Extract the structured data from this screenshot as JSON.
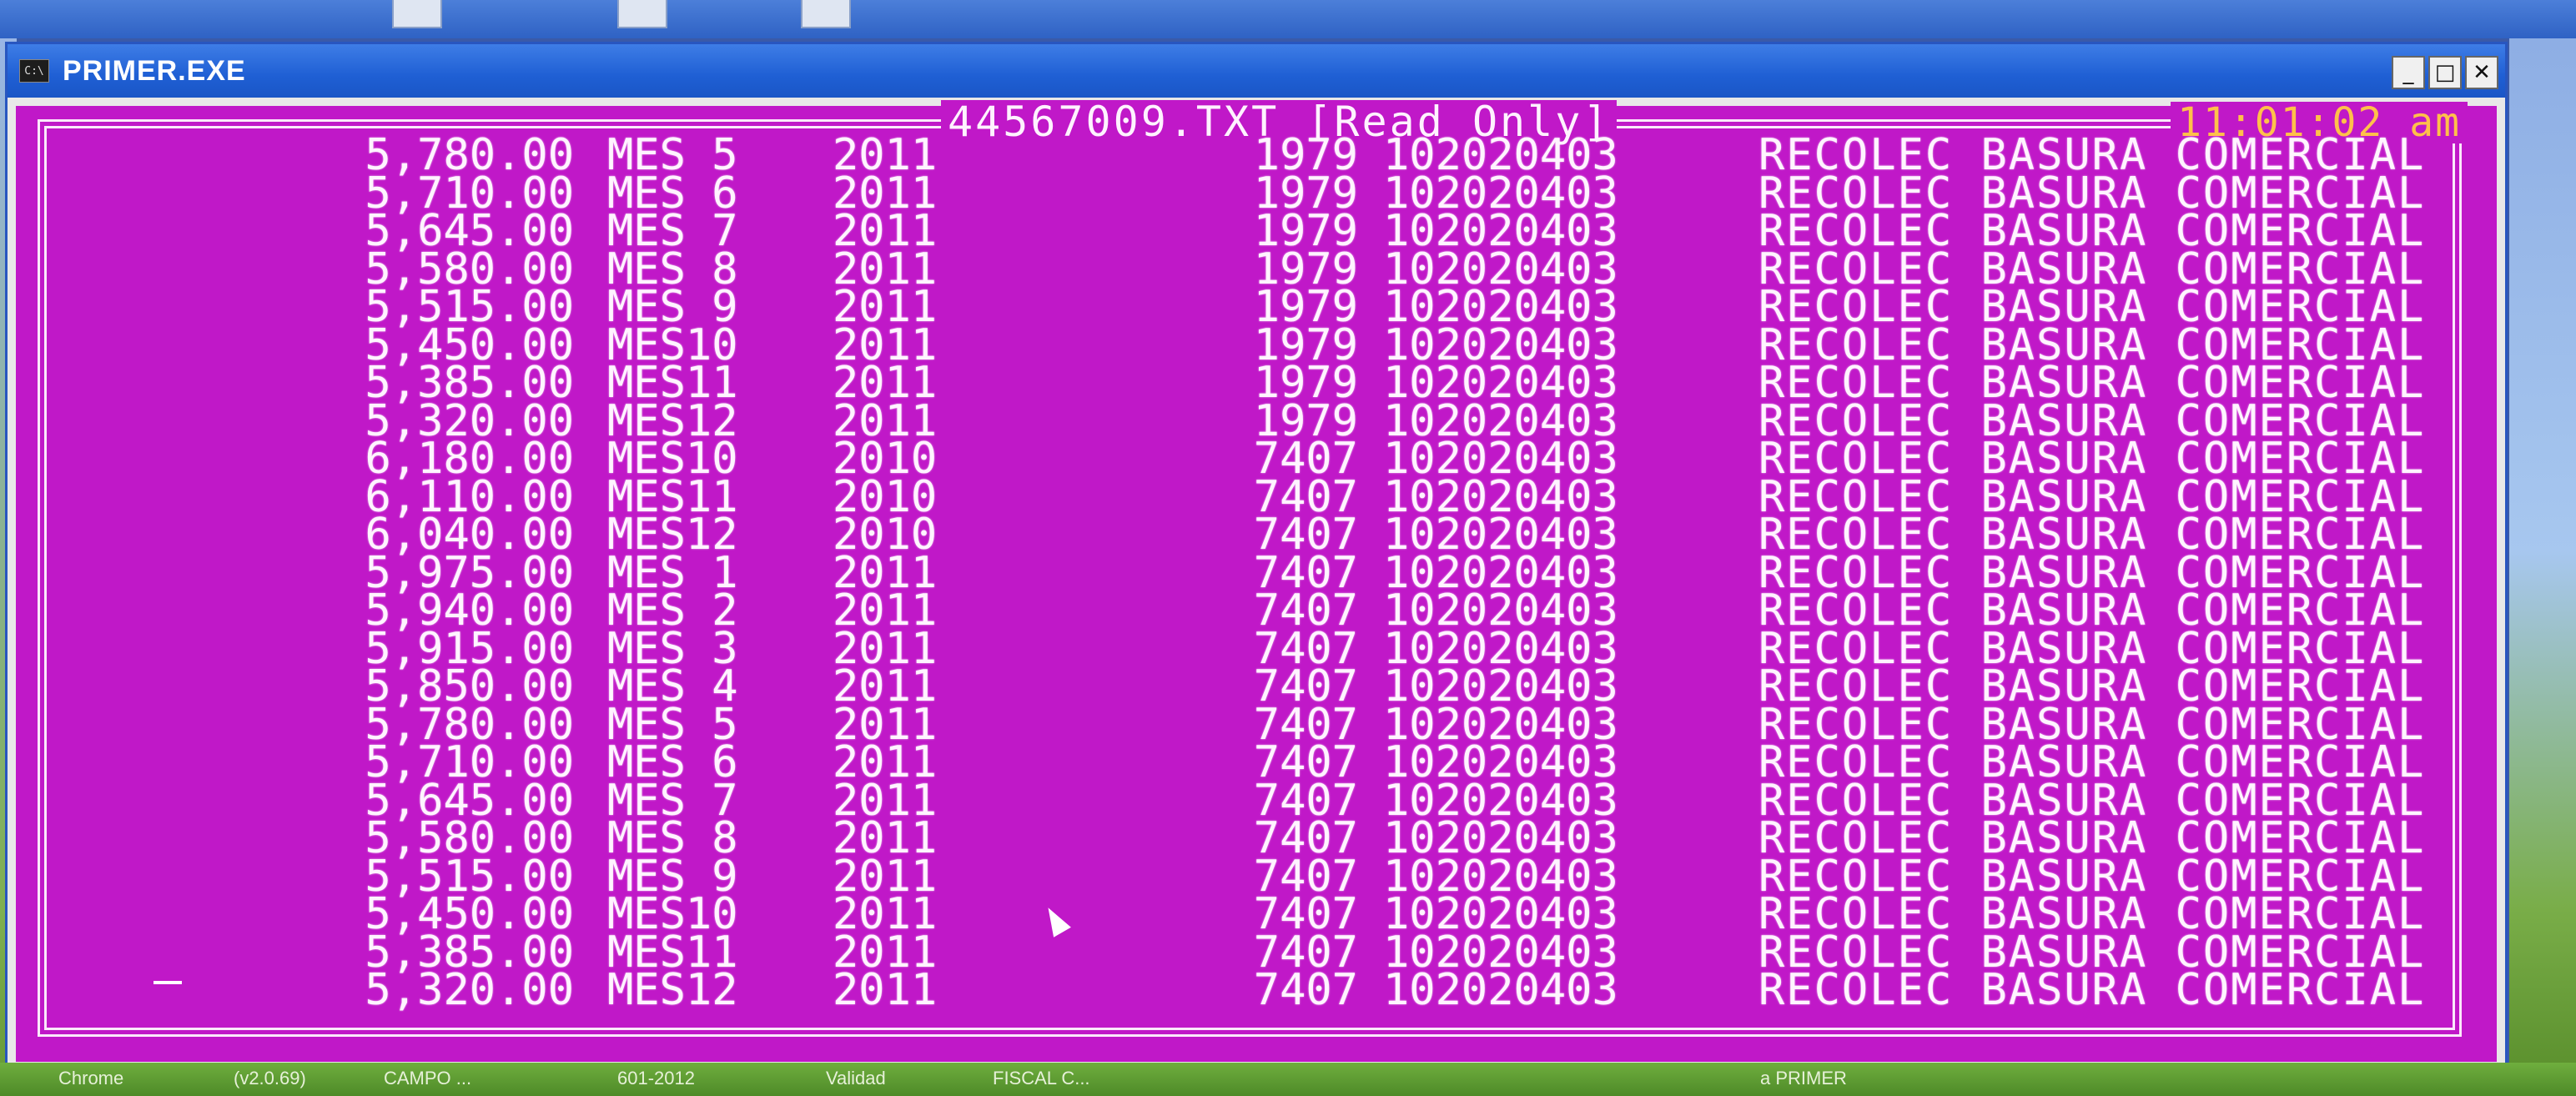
{
  "window": {
    "title": "PRIMER.EXE",
    "icon_label": "C:\\"
  },
  "controls": {
    "minimize": "_",
    "maximize": "□",
    "close": "✕"
  },
  "console": {
    "header": "44567009.TXT [Read Only]",
    "clock": "11:01:02 am",
    "rows": [
      {
        "amount": "5,780.00",
        "month": "MES 5",
        "year": "2011",
        "code": "1979",
        "account": "102020403",
        "desc": "RECOLEC BASURA COMERCIAL"
      },
      {
        "amount": "5,710.00",
        "month": "MES 6",
        "year": "2011",
        "code": "1979",
        "account": "102020403",
        "desc": "RECOLEC BASURA COMERCIAL"
      },
      {
        "amount": "5,645.00",
        "month": "MES 7",
        "year": "2011",
        "code": "1979",
        "account": "102020403",
        "desc": "RECOLEC BASURA COMERCIAL"
      },
      {
        "amount": "5,580.00",
        "month": "MES 8",
        "year": "2011",
        "code": "1979",
        "account": "102020403",
        "desc": "RECOLEC BASURA COMERCIAL"
      },
      {
        "amount": "5,515.00",
        "month": "MES 9",
        "year": "2011",
        "code": "1979",
        "account": "102020403",
        "desc": "RECOLEC BASURA COMERCIAL"
      },
      {
        "amount": "5,450.00",
        "month": "MES10",
        "year": "2011",
        "code": "1979",
        "account": "102020403",
        "desc": "RECOLEC BASURA COMERCIAL"
      },
      {
        "amount": "5,385.00",
        "month": "MES11",
        "year": "2011",
        "code": "1979",
        "account": "102020403",
        "desc": "RECOLEC BASURA COMERCIAL"
      },
      {
        "amount": "5,320.00",
        "month": "MES12",
        "year": "2011",
        "code": "1979",
        "account": "102020403",
        "desc": "RECOLEC BASURA COMERCIAL"
      },
      {
        "amount": "6,180.00",
        "month": "MES10",
        "year": "2010",
        "code": "7407",
        "account": "102020403",
        "desc": "RECOLEC BASURA COMERCIAL"
      },
      {
        "amount": "6,110.00",
        "month": "MES11",
        "year": "2010",
        "code": "7407",
        "account": "102020403",
        "desc": "RECOLEC BASURA COMERCIAL"
      },
      {
        "amount": "6,040.00",
        "month": "MES12",
        "year": "2010",
        "code": "7407",
        "account": "102020403",
        "desc": "RECOLEC BASURA COMERCIAL"
      },
      {
        "amount": "5,975.00",
        "month": "MES 1",
        "year": "2011",
        "code": "7407",
        "account": "102020403",
        "desc": "RECOLEC BASURA COMERCIAL"
      },
      {
        "amount": "5,940.00",
        "month": "MES 2",
        "year": "2011",
        "code": "7407",
        "account": "102020403",
        "desc": "RECOLEC BASURA COMERCIAL"
      },
      {
        "amount": "5,915.00",
        "month": "MES 3",
        "year": "2011",
        "code": "7407",
        "account": "102020403",
        "desc": "RECOLEC BASURA COMERCIAL"
      },
      {
        "amount": "5,850.00",
        "month": "MES 4",
        "year": "2011",
        "code": "7407",
        "account": "102020403",
        "desc": "RECOLEC BASURA COMERCIAL"
      },
      {
        "amount": "5,780.00",
        "month": "MES 5",
        "year": "2011",
        "code": "7407",
        "account": "102020403",
        "desc": "RECOLEC BASURA COMERCIAL"
      },
      {
        "amount": "5,710.00",
        "month": "MES 6",
        "year": "2011",
        "code": "7407",
        "account": "102020403",
        "desc": "RECOLEC BASURA COMERCIAL"
      },
      {
        "amount": "5,645.00",
        "month": "MES 7",
        "year": "2011",
        "code": "7407",
        "account": "102020403",
        "desc": "RECOLEC BASURA COMERCIAL"
      },
      {
        "amount": "5,580.00",
        "month": "MES 8",
        "year": "2011",
        "code": "7407",
        "account": "102020403",
        "desc": "RECOLEC BASURA COMERCIAL"
      },
      {
        "amount": "5,515.00",
        "month": "MES 9",
        "year": "2011",
        "code": "7407",
        "account": "102020403",
        "desc": "RECOLEC BASURA COMERCIAL"
      },
      {
        "amount": "5,450.00",
        "month": "MES10",
        "year": "2011",
        "code": "7407",
        "account": "102020403",
        "desc": "RECOLEC BASURA COMERCIAL"
      },
      {
        "amount": "5,385.00",
        "month": "MES11",
        "year": "2011",
        "code": "7407",
        "account": "102020403",
        "desc": "RECOLEC BASURA COMERCIAL"
      },
      {
        "amount": "5,320.00",
        "month": "MES12",
        "year": "2011",
        "code": "7407",
        "account": "102020403",
        "desc": "RECOLEC BASURA COMERCIAL"
      }
    ]
  },
  "taskbar": {
    "items": [
      "Chrome",
      "(v2.0.69)",
      "CAMPO ...",
      "601-2012",
      "Validad",
      "FISCAL C...",
      "a PRIMER"
    ]
  },
  "colors": {
    "console_bg": "#c018c8",
    "console_text": "#fff4ff",
    "clock_text": "#ffc04a",
    "titlebar": "#1f5fd4"
  }
}
